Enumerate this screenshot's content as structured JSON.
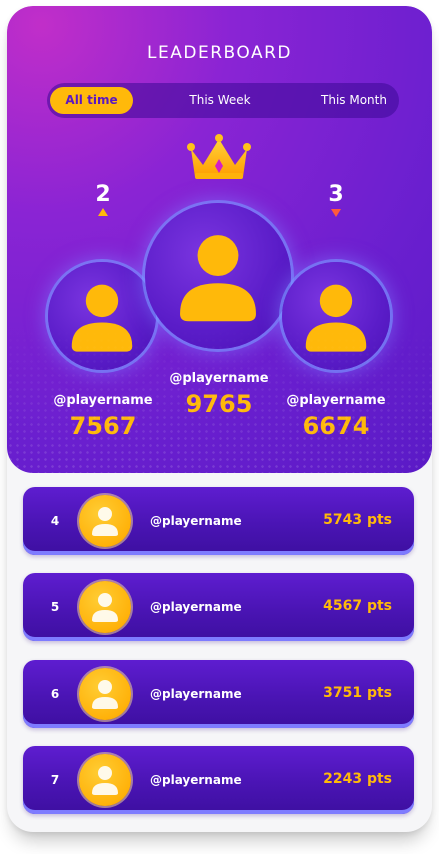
{
  "header": {
    "title": "LEADERBOARD"
  },
  "tabs": [
    {
      "label": "All time",
      "active": true
    },
    {
      "label": "This Week",
      "active": false
    },
    {
      "label": "This Month",
      "active": false
    }
  ],
  "podium": [
    {
      "rank": "2",
      "trend": "up",
      "username": "@playername",
      "score": "7567"
    },
    {
      "rank": "1",
      "trend": "crown",
      "username": "@playername",
      "score": "9765"
    },
    {
      "rank": "3",
      "trend": "down",
      "username": "@playername",
      "score": "6674"
    }
  ],
  "list": [
    {
      "rank": "4",
      "username": "@playername",
      "points": "5743 pts"
    },
    {
      "rank": "5",
      "username": "@playername",
      "points": "4567 pts"
    },
    {
      "rank": "6",
      "username": "@playername",
      "points": "3751 pts"
    },
    {
      "rank": "7",
      "username": "@playername",
      "points": "2243 pts"
    }
  ],
  "colors": {
    "accent": "#ffb90a",
    "hero_start": "#c12ec9",
    "hero_end": "#5a1ac6",
    "row": "#4a14b4",
    "up_arrow": "#ffb90a",
    "down_arrow": "#ff5a3c"
  },
  "icons": {
    "crown": "crown-icon",
    "avatar": "user-avatar-icon",
    "up": "arrow-up-icon",
    "down": "arrow-down-icon"
  }
}
